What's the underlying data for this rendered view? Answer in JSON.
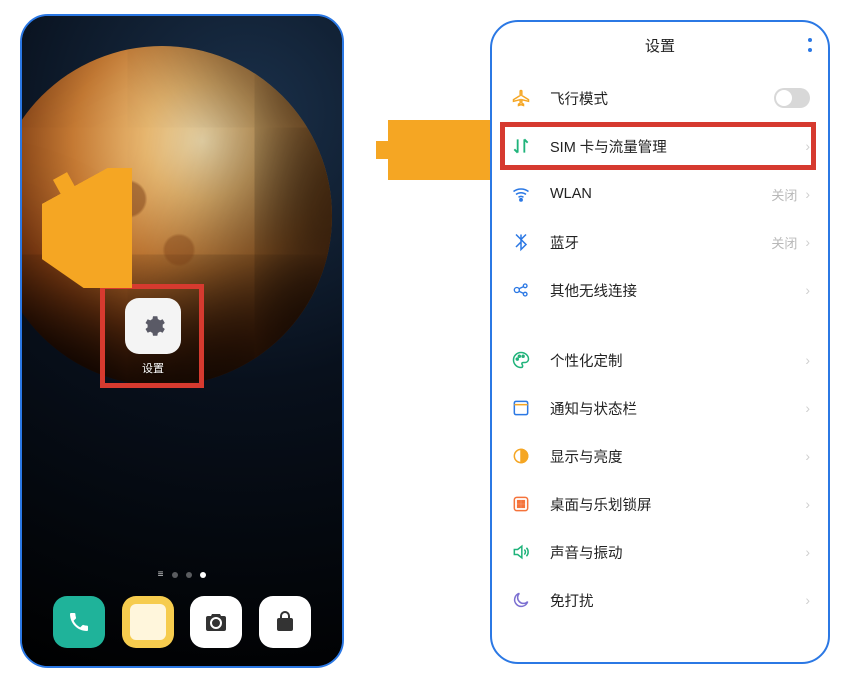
{
  "home": {
    "settings_app_label": "设置",
    "dock": [
      "phone",
      "notes",
      "camera",
      "appstore"
    ]
  },
  "settings": {
    "title": "设置",
    "rows": [
      {
        "icon": "airplane",
        "label": "飞行模式",
        "trailing": "",
        "control": "toggle"
      },
      {
        "icon": "sim",
        "label": "SIM 卡与流量管理",
        "trailing": "",
        "control": "chevron",
        "highlight": true
      },
      {
        "icon": "wifi",
        "label": "WLAN",
        "trailing": "关闭",
        "control": "chevron"
      },
      {
        "icon": "bluetooth",
        "label": "蓝牙",
        "trailing": "关闭",
        "control": "chevron"
      },
      {
        "icon": "wireless",
        "label": "其他无线连接",
        "trailing": "",
        "control": "chevron"
      }
    ],
    "rows2": [
      {
        "icon": "theme",
        "label": "个性化定制",
        "trailing": "",
        "control": "chevron"
      },
      {
        "icon": "notif",
        "label": "通知与状态栏",
        "trailing": "",
        "control": "chevron"
      },
      {
        "icon": "display",
        "label": "显示与亮度",
        "trailing": "",
        "control": "chevron"
      },
      {
        "icon": "launcher",
        "label": "桌面与乐划锁屏",
        "trailing": "",
        "control": "chevron"
      },
      {
        "icon": "sound",
        "label": "声音与振动",
        "trailing": "",
        "control": "chevron"
      },
      {
        "icon": "dnd",
        "label": "免打扰",
        "trailing": "",
        "control": "chevron"
      }
    ]
  },
  "colors": {
    "highlight": "#d63a2f",
    "arrow": "#f5a623",
    "frame": "#2b78e4"
  }
}
